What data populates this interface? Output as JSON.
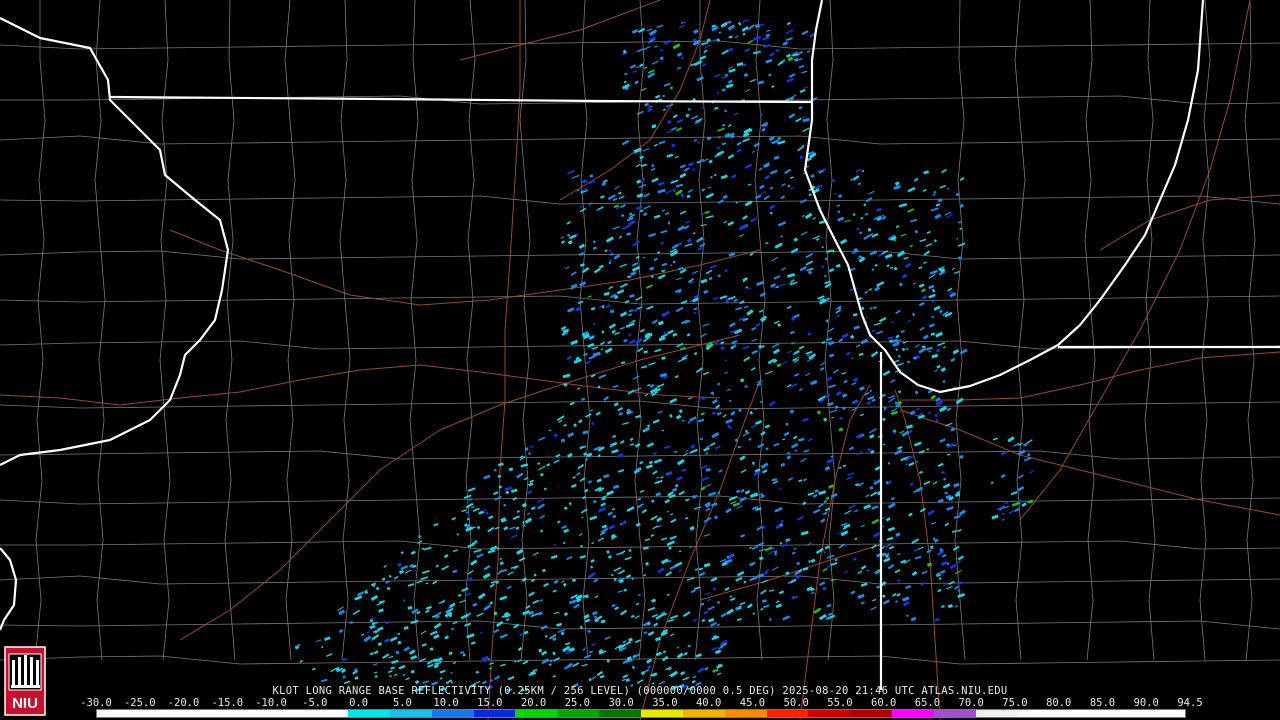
{
  "caption": "KLOT LONG RANGE BASE REFLECTIVITY (0.25KM / 256 LEVEL) (000000/0000 0.5 DEG) 2025-08-20 21:46 UTC  ATLAS.NIU.EDU",
  "logo_text": "NIU",
  "scale": {
    "labels": [
      "-30.0",
      "-25.0",
      "-20.0",
      "-15.0",
      "-10.0",
      "-5.0",
      "0.0",
      "5.0",
      "10.0",
      "15.0",
      "20.0",
      "25.0",
      "30.0",
      "35.0",
      "40.0",
      "45.0",
      "50.0",
      "55.0",
      "60.0",
      "65.0",
      "70.0",
      "75.0",
      "80.0",
      "85.0",
      "90.0",
      "94.5"
    ],
    "colors": [
      "#ffffff",
      "#ffffff",
      "#ffffff",
      "#ffffff",
      "#ffffff",
      "#ffffff",
      "#00e5e5",
      "#19c0ee",
      "#1478ee",
      "#0a28e0",
      "#00d800",
      "#00a800",
      "#007800",
      "#e8e800",
      "#f0b400",
      "#ff8c00",
      "#ff2000",
      "#d00000",
      "#b00000",
      "#ff00ff",
      "#a050d0",
      "#f0f0f0",
      "#ffffff",
      "#ffffff",
      "#ffffff",
      "#ffffff"
    ]
  },
  "map_colors": {
    "state_line": "#ffffff",
    "county_line": "#7a7a7a",
    "road_line": "#9a4a2c",
    "echo_light": "#19d8e6",
    "echo_mid": "#1a8ef0",
    "echo_dark": "#1238e8",
    "echo_green": "#18c818"
  }
}
